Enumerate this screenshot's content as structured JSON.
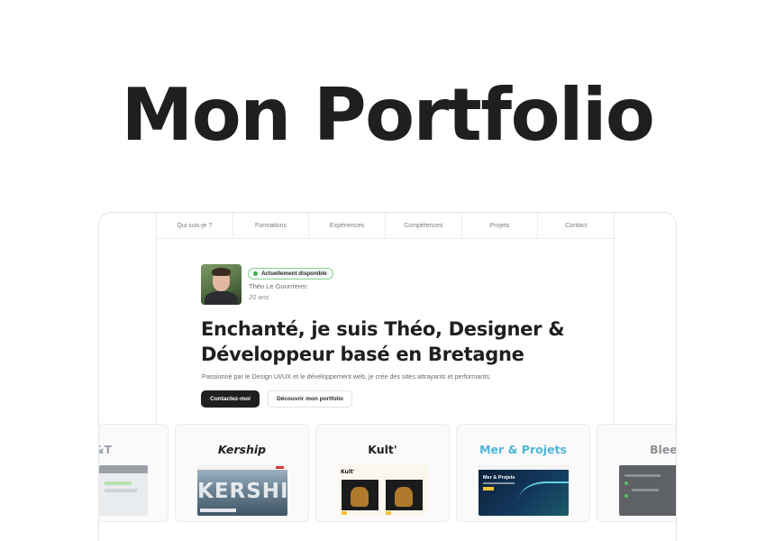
{
  "page": {
    "title": "Mon Portfolio"
  },
  "nav": {
    "items": [
      "Qui suis-je ?",
      "Formations",
      "Expériences",
      "Compétences",
      "Projets",
      "Contact"
    ]
  },
  "profile": {
    "status": "Actuellement disponible",
    "name": "Théo Le Gourrierec",
    "age": "20 ans",
    "status_color": "#34b24b"
  },
  "hero": {
    "headline": "Enchanté, je suis Théo, Designer & Développeur basé en Bretagne",
    "subline": "Passionné par le Design UI/UX et le développement web, je crée des sites attrayants et performants.",
    "primary_button": "Contactez-moi",
    "secondary_button": "Découvrir mon portfolio"
  },
  "projects": {
    "left_partial": "&T",
    "items": [
      {
        "title": "Kership",
        "shot_text": "KERSHIP"
      },
      {
        "title": "Kult'",
        "shot_text": "Kult'"
      },
      {
        "title": "Mer & Projets",
        "shot_text": "Mer & Projets",
        "title_color": "#4fb6d6"
      }
    ],
    "right_partial": "Bleep"
  }
}
